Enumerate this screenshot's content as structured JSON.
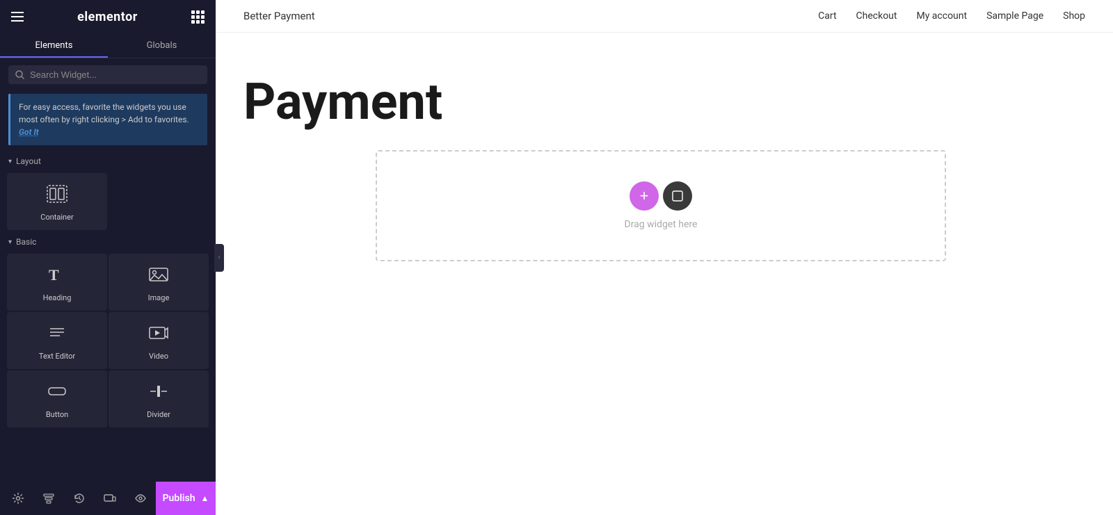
{
  "sidebar": {
    "logo": "elementor",
    "tabs": [
      {
        "id": "elements",
        "label": "Elements",
        "active": true
      },
      {
        "id": "globals",
        "label": "Globals",
        "active": false
      }
    ],
    "search": {
      "placeholder": "Search Widget..."
    },
    "tip_banner": {
      "text": "For easy access, favorite the widgets you use most often by right clicking > Add to favorites.",
      "cta": "Got It"
    },
    "sections": [
      {
        "id": "layout",
        "label": "Layout",
        "expanded": true,
        "widgets": [
          {
            "id": "container",
            "label": "Container",
            "icon": "container"
          }
        ]
      },
      {
        "id": "basic",
        "label": "Basic",
        "expanded": true,
        "widgets": [
          {
            "id": "heading",
            "label": "Heading",
            "icon": "heading"
          },
          {
            "id": "image",
            "label": "Image",
            "icon": "image"
          },
          {
            "id": "text-editor",
            "label": "Text Editor",
            "icon": "text-editor"
          },
          {
            "id": "video",
            "label": "Video",
            "icon": "video"
          },
          {
            "id": "button",
            "label": "Button",
            "icon": "button"
          },
          {
            "id": "divider",
            "label": "Divider",
            "icon": "divider"
          }
        ]
      }
    ],
    "toolbar": {
      "settings_label": "Settings",
      "navigator_label": "Navigator",
      "history_label": "History",
      "responsive_label": "Responsive",
      "preview_label": "Preview",
      "publish_label": "Publish"
    }
  },
  "canvas": {
    "site_name": "Better Payment",
    "nav_links": [
      "Cart",
      "Checkout",
      "My account",
      "Sample Page",
      "Shop"
    ],
    "page_title": "Payment",
    "drop_zone": {
      "hint": "Drag widget here"
    }
  }
}
